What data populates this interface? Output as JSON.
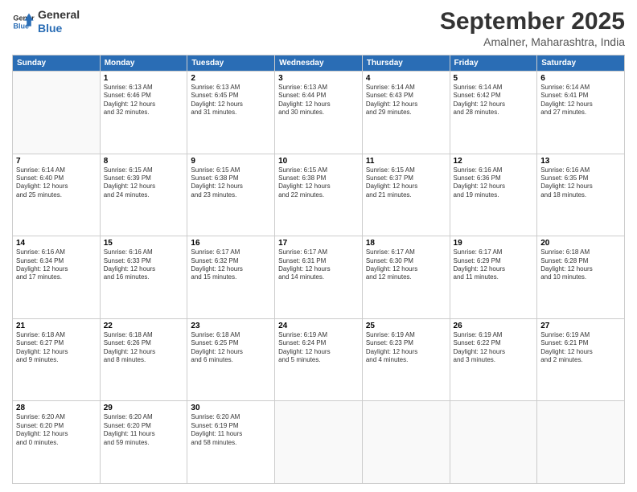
{
  "header": {
    "logo_line1": "General",
    "logo_line2": "Blue",
    "month": "September 2025",
    "location": "Amalner, Maharashtra, India"
  },
  "days_of_week": [
    "Sunday",
    "Monday",
    "Tuesday",
    "Wednesday",
    "Thursday",
    "Friday",
    "Saturday"
  ],
  "weeks": [
    [
      {
        "day": "",
        "text": ""
      },
      {
        "day": "1",
        "text": "Sunrise: 6:13 AM\nSunset: 6:46 PM\nDaylight: 12 hours\nand 32 minutes."
      },
      {
        "day": "2",
        "text": "Sunrise: 6:13 AM\nSunset: 6:45 PM\nDaylight: 12 hours\nand 31 minutes."
      },
      {
        "day": "3",
        "text": "Sunrise: 6:13 AM\nSunset: 6:44 PM\nDaylight: 12 hours\nand 30 minutes."
      },
      {
        "day": "4",
        "text": "Sunrise: 6:14 AM\nSunset: 6:43 PM\nDaylight: 12 hours\nand 29 minutes."
      },
      {
        "day": "5",
        "text": "Sunrise: 6:14 AM\nSunset: 6:42 PM\nDaylight: 12 hours\nand 28 minutes."
      },
      {
        "day": "6",
        "text": "Sunrise: 6:14 AM\nSunset: 6:41 PM\nDaylight: 12 hours\nand 27 minutes."
      }
    ],
    [
      {
        "day": "7",
        "text": "Sunrise: 6:14 AM\nSunset: 6:40 PM\nDaylight: 12 hours\nand 25 minutes."
      },
      {
        "day": "8",
        "text": "Sunrise: 6:15 AM\nSunset: 6:39 PM\nDaylight: 12 hours\nand 24 minutes."
      },
      {
        "day": "9",
        "text": "Sunrise: 6:15 AM\nSunset: 6:38 PM\nDaylight: 12 hours\nand 23 minutes."
      },
      {
        "day": "10",
        "text": "Sunrise: 6:15 AM\nSunset: 6:38 PM\nDaylight: 12 hours\nand 22 minutes."
      },
      {
        "day": "11",
        "text": "Sunrise: 6:15 AM\nSunset: 6:37 PM\nDaylight: 12 hours\nand 21 minutes."
      },
      {
        "day": "12",
        "text": "Sunrise: 6:16 AM\nSunset: 6:36 PM\nDaylight: 12 hours\nand 19 minutes."
      },
      {
        "day": "13",
        "text": "Sunrise: 6:16 AM\nSunset: 6:35 PM\nDaylight: 12 hours\nand 18 minutes."
      }
    ],
    [
      {
        "day": "14",
        "text": "Sunrise: 6:16 AM\nSunset: 6:34 PM\nDaylight: 12 hours\nand 17 minutes."
      },
      {
        "day": "15",
        "text": "Sunrise: 6:16 AM\nSunset: 6:33 PM\nDaylight: 12 hours\nand 16 minutes."
      },
      {
        "day": "16",
        "text": "Sunrise: 6:17 AM\nSunset: 6:32 PM\nDaylight: 12 hours\nand 15 minutes."
      },
      {
        "day": "17",
        "text": "Sunrise: 6:17 AM\nSunset: 6:31 PM\nDaylight: 12 hours\nand 14 minutes."
      },
      {
        "day": "18",
        "text": "Sunrise: 6:17 AM\nSunset: 6:30 PM\nDaylight: 12 hours\nand 12 minutes."
      },
      {
        "day": "19",
        "text": "Sunrise: 6:17 AM\nSunset: 6:29 PM\nDaylight: 12 hours\nand 11 minutes."
      },
      {
        "day": "20",
        "text": "Sunrise: 6:18 AM\nSunset: 6:28 PM\nDaylight: 12 hours\nand 10 minutes."
      }
    ],
    [
      {
        "day": "21",
        "text": "Sunrise: 6:18 AM\nSunset: 6:27 PM\nDaylight: 12 hours\nand 9 minutes."
      },
      {
        "day": "22",
        "text": "Sunrise: 6:18 AM\nSunset: 6:26 PM\nDaylight: 12 hours\nand 8 minutes."
      },
      {
        "day": "23",
        "text": "Sunrise: 6:18 AM\nSunset: 6:25 PM\nDaylight: 12 hours\nand 6 minutes."
      },
      {
        "day": "24",
        "text": "Sunrise: 6:19 AM\nSunset: 6:24 PM\nDaylight: 12 hours\nand 5 minutes."
      },
      {
        "day": "25",
        "text": "Sunrise: 6:19 AM\nSunset: 6:23 PM\nDaylight: 12 hours\nand 4 minutes."
      },
      {
        "day": "26",
        "text": "Sunrise: 6:19 AM\nSunset: 6:22 PM\nDaylight: 12 hours\nand 3 minutes."
      },
      {
        "day": "27",
        "text": "Sunrise: 6:19 AM\nSunset: 6:21 PM\nDaylight: 12 hours\nand 2 minutes."
      }
    ],
    [
      {
        "day": "28",
        "text": "Sunrise: 6:20 AM\nSunset: 6:20 PM\nDaylight: 12 hours\nand 0 minutes."
      },
      {
        "day": "29",
        "text": "Sunrise: 6:20 AM\nSunset: 6:20 PM\nDaylight: 11 hours\nand 59 minutes."
      },
      {
        "day": "30",
        "text": "Sunrise: 6:20 AM\nSunset: 6:19 PM\nDaylight: 11 hours\nand 58 minutes."
      },
      {
        "day": "",
        "text": ""
      },
      {
        "day": "",
        "text": ""
      },
      {
        "day": "",
        "text": ""
      },
      {
        "day": "",
        "text": ""
      }
    ]
  ]
}
